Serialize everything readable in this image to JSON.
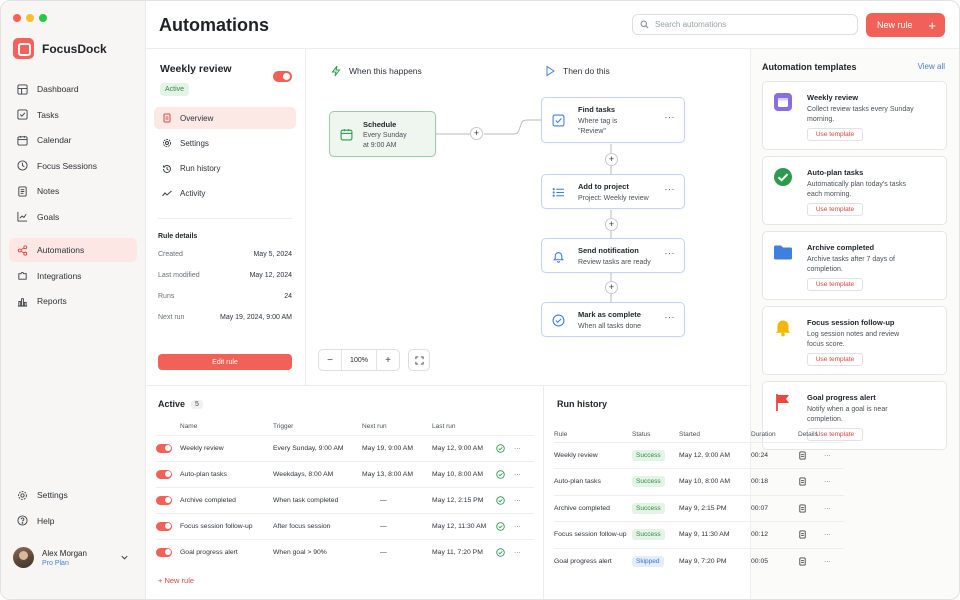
{
  "app": {
    "name": "FocusDock",
    "page_title": "Automations",
    "accent": "#f26158"
  },
  "search": {
    "placeholder": "Search automations"
  },
  "header": {
    "new_rule_label": "New rule"
  },
  "sidebar": {
    "items": [
      {
        "label": "Dashboard",
        "icon": "dashboard-icon"
      },
      {
        "label": "Tasks",
        "icon": "checkbox-icon"
      },
      {
        "label": "Calendar",
        "icon": "calendar-icon"
      },
      {
        "label": "Focus Sessions",
        "icon": "clock-icon"
      },
      {
        "label": "Notes",
        "icon": "note-icon"
      },
      {
        "label": "Goals",
        "icon": "chart-icon"
      },
      {
        "label": "Automations",
        "icon": "share-icon",
        "active": true
      },
      {
        "label": "Integrations",
        "icon": "puzzle-icon"
      },
      {
        "label": "Reports",
        "icon": "bar-chart-icon"
      }
    ],
    "bottom": [
      {
        "label": "Settings",
        "icon": "gear-icon"
      },
      {
        "label": "Help",
        "icon": "help-icon"
      }
    ],
    "user": {
      "name": "Alex Morgan",
      "plan": "Pro Plan"
    }
  },
  "rule": {
    "title": "Weekly review",
    "status": "Active",
    "nav": [
      {
        "label": "Overview",
        "active": true
      },
      {
        "label": "Settings"
      },
      {
        "label": "Run history"
      },
      {
        "label": "Activity"
      }
    ],
    "details_heading": "Rule details",
    "details": [
      {
        "key": "Created",
        "value": "May 5, 2024"
      },
      {
        "key": "Last modified",
        "value": "May 12, 2024"
      },
      {
        "key": "Runs",
        "value": "24"
      },
      {
        "key": "Next run",
        "value": "May 19, 2024, 9:00 AM"
      }
    ],
    "edit_label": "Edit rule"
  },
  "canvas": {
    "when_label": "When this happens",
    "then_label": "Then do this",
    "trigger": {
      "title": "Schedule",
      "sub1": "Every Sunday",
      "sub2": "at 9:00 AM"
    },
    "steps": [
      {
        "title": "Find tasks",
        "sub1": "Where tag is",
        "sub2": "\"Review\"",
        "icon": "checkbox-icon"
      },
      {
        "title": "Add to project",
        "sub1": "Project: Weekly review",
        "sub2": "",
        "icon": "list-icon"
      },
      {
        "title": "Send notification",
        "sub1": "Review tasks are ready",
        "sub2": "",
        "icon": "bell-icon"
      },
      {
        "title": "Mark as complete",
        "sub1": "When all tasks done",
        "sub2": "",
        "icon": "check-circle-icon"
      }
    ],
    "zoom_level": "100%"
  },
  "templates": {
    "heading": "Automation templates",
    "view_all": "View all",
    "use_label": "Use template",
    "items": [
      {
        "title": "Weekly review",
        "desc": "Collect review tasks every Sunday morning.",
        "icon": "calendar-tile-icon",
        "color": "#8a6ee0"
      },
      {
        "title": "Auto-plan tasks",
        "desc": "Automatically plan today's tasks each morning.",
        "icon": "check-circle-icon",
        "color": "#2e9a4f"
      },
      {
        "title": "Archive completed",
        "desc": "Archive tasks after 7 days of completion.",
        "icon": "folder-icon",
        "color": "#3f7fe0"
      },
      {
        "title": "Focus session follow-up",
        "desc": "Log session notes and review focus score.",
        "icon": "bell-icon",
        "color": "#f2b705"
      },
      {
        "title": "Goal progress alert",
        "desc": "Notify when a goal is near completion.",
        "icon": "flag-icon",
        "color": "#e8483f"
      }
    ]
  },
  "active": {
    "title": "Active",
    "count": "5",
    "columns": [
      "Name",
      "Trigger",
      "Next run",
      "Last run"
    ],
    "rows": [
      {
        "name": "Weekly review",
        "trigger": "Every Sunday, 9:00 AM",
        "next": "May 19, 9:00 AM",
        "last": "May 12, 9:00 AM"
      },
      {
        "name": "Auto-plan tasks",
        "trigger": "Weekdays, 8:00 AM",
        "next": "May 13, 8:00 AM",
        "last": "May 10, 8:00 AM"
      },
      {
        "name": "Archive completed",
        "trigger": "When task completed",
        "next": "—",
        "last": "May 12, 2:15 PM"
      },
      {
        "name": "Focus session follow-up",
        "trigger": "After focus session",
        "next": "—",
        "last": "May 12, 11:30 AM"
      },
      {
        "name": "Goal progress alert",
        "trigger": "When goal > 90%",
        "next": "—",
        "last": "May 11, 7:20 PM"
      }
    ],
    "new_rule_link": "+ New rule"
  },
  "history": {
    "title": "Run history",
    "columns": [
      "Rule",
      "Status",
      "Started",
      "Duration",
      "Details"
    ],
    "rows": [
      {
        "rule": "Weekly review",
        "status": "Success",
        "started": "May 12, 9:00 AM",
        "duration": "00:24"
      },
      {
        "rule": "Auto-plan tasks",
        "status": "Success",
        "started": "May 10, 8:00 AM",
        "duration": "00:18"
      },
      {
        "rule": "Archive completed",
        "status": "Success",
        "started": "May 9, 2:15 PM",
        "duration": "00:07"
      },
      {
        "rule": "Focus session follow-up",
        "status": "Success",
        "started": "May 9, 11:30 AM",
        "duration": "00:12"
      },
      {
        "rule": "Goal progress alert",
        "status": "Skipped",
        "started": "May 9, 7:20 PM",
        "duration": "00:05"
      }
    ]
  }
}
